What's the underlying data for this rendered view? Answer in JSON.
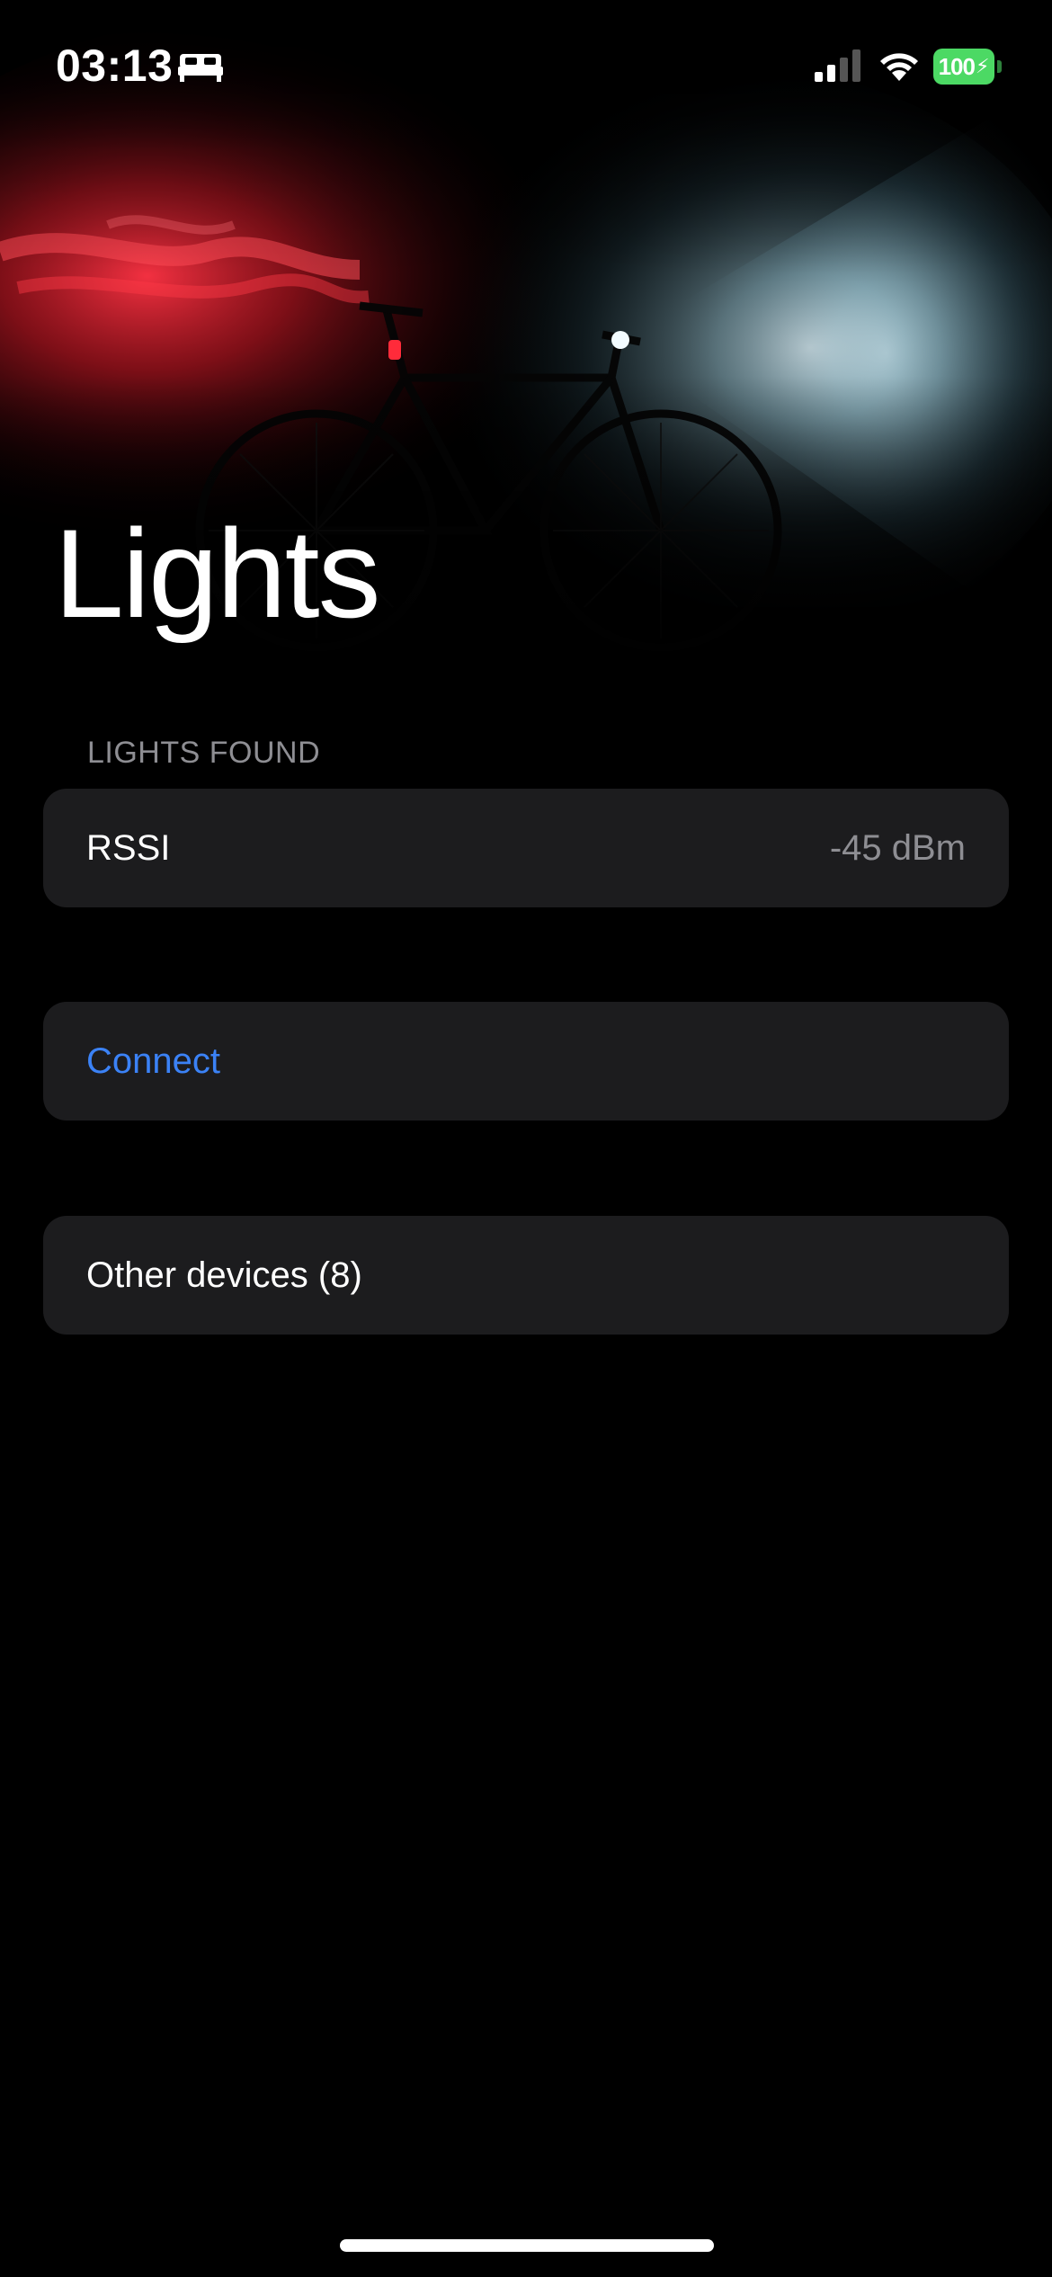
{
  "status_bar": {
    "time": "03:13",
    "battery_level": "100",
    "focus_mode_icon": "bed-icon",
    "signal_bars_active": 2,
    "signal_bars_total": 4,
    "battery_color": "#4cd964"
  },
  "header": {
    "title": "Lights",
    "image": "bicycle-with-red-and-white-lights"
  },
  "sections": {
    "lights_found": {
      "header": "LIGHTS FOUND",
      "rows": [
        {
          "label": "RSSI",
          "value": "-45 dBm"
        }
      ]
    },
    "actions": {
      "connect_label": "Connect"
    },
    "other": {
      "label": "Other devices (8)"
    }
  },
  "colors": {
    "background": "#000000",
    "cell_background": "#1c1c1e",
    "accent": "#3b82f6",
    "secondary_text": "#8e8e93"
  }
}
